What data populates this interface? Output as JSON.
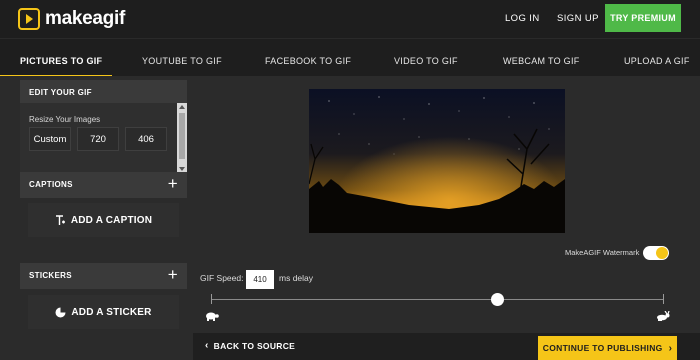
{
  "header": {
    "brand": "makeagif",
    "login_label": "LOG IN",
    "signup_label": "SIGN UP",
    "premium_label": "TRY PREMIUM"
  },
  "tabs": [
    {
      "label": "PICTURES TO GIF",
      "active": true
    },
    {
      "label": "YOUTUBE TO GIF",
      "active": false
    },
    {
      "label": "FACEBOOK TO GIF",
      "active": false
    },
    {
      "label": "VIDEO TO GIF",
      "active": false
    },
    {
      "label": "WEBCAM TO GIF",
      "active": false
    },
    {
      "label": "UPLOAD A GIF",
      "active": false
    }
  ],
  "editor": {
    "section_title": "EDIT YOUR GIF",
    "resize_label": "Resize Your Images",
    "resize_mode": "Custom",
    "width": "720",
    "height": "406"
  },
  "captions": {
    "title": "CAPTIONS",
    "add_label": "ADD A CAPTION",
    "add_icon": "text-caption-icon"
  },
  "stickers": {
    "title": "STICKERS",
    "add_label": "ADD A STICKER",
    "add_icon": "sticker-icon"
  },
  "preview": {
    "description_icon": "night-sky-preview-image"
  },
  "watermark": {
    "label": "MakeAGIF Watermark",
    "enabled": true
  },
  "speed": {
    "label": "GIF Speed:",
    "value": "410",
    "unit": "ms delay",
    "slider_fraction": 0.62,
    "slow_icon": "turtle-icon",
    "fast_icon": "rabbit-icon"
  },
  "footer": {
    "back_label": "BACK TO SOURCE",
    "continue_label": "CONTINUE TO PUBLISHING"
  },
  "colors": {
    "accent": "#f5c518",
    "premium": "#4fb948",
    "background": "#2b2b2b",
    "header": "#1e1e1e"
  }
}
